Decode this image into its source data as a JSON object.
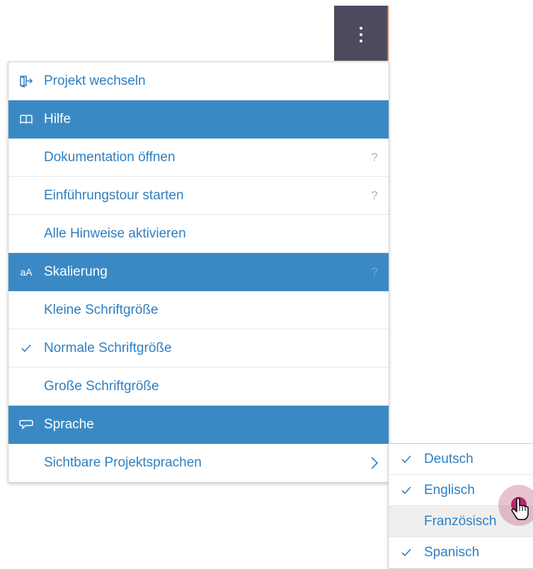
{
  "menu": {
    "items": [
      {
        "type": "item",
        "icon": "switch-project-icon",
        "label": "Projekt wechseln",
        "help": "",
        "chevron": false,
        "checked": false
      },
      {
        "type": "header",
        "icon": "book-icon",
        "label": "Hilfe",
        "help": "",
        "chevron": false,
        "checked": false
      },
      {
        "type": "item",
        "icon": "",
        "label": "Dokumentation öffnen",
        "help": "?",
        "chevron": false,
        "checked": false
      },
      {
        "type": "item",
        "icon": "",
        "label": "Einführungstour starten",
        "help": "?",
        "chevron": false,
        "checked": false
      },
      {
        "type": "item",
        "icon": "",
        "label": "Alle Hinweise aktivieren",
        "help": "",
        "chevron": false,
        "checked": false
      },
      {
        "type": "header",
        "icon": "font-size-icon",
        "icon_text": "aA",
        "label": "Skalierung",
        "help": "?",
        "chevron": false,
        "checked": false
      },
      {
        "type": "item",
        "icon": "",
        "label": "Kleine Schriftgröße",
        "help": "",
        "chevron": false,
        "checked": false
      },
      {
        "type": "item",
        "icon": "check-icon",
        "label": "Normale Schriftgröße",
        "help": "",
        "chevron": false,
        "checked": true
      },
      {
        "type": "item",
        "icon": "",
        "label": "Große Schriftgröße",
        "help": "",
        "chevron": false,
        "checked": false
      },
      {
        "type": "header",
        "icon": "speech-bubble-icon",
        "label": "Sprache",
        "help": "",
        "chevron": false,
        "checked": false
      },
      {
        "type": "item",
        "icon": "",
        "label": "Sichtbare Projektsprachen",
        "help": "",
        "chevron": true,
        "checked": false
      }
    ]
  },
  "submenu": {
    "items": [
      {
        "label": "Deutsch",
        "checked": true,
        "hover": false
      },
      {
        "label": "Englisch",
        "checked": true,
        "hover": false
      },
      {
        "label": "Französisch",
        "checked": false,
        "hover": true
      },
      {
        "label": "Spanisch",
        "checked": true,
        "hover": false
      }
    ]
  },
  "colors": {
    "header_bg": "#3a89c5",
    "link": "#2f7fc0",
    "kebab_bg": "#4e4a5e"
  }
}
